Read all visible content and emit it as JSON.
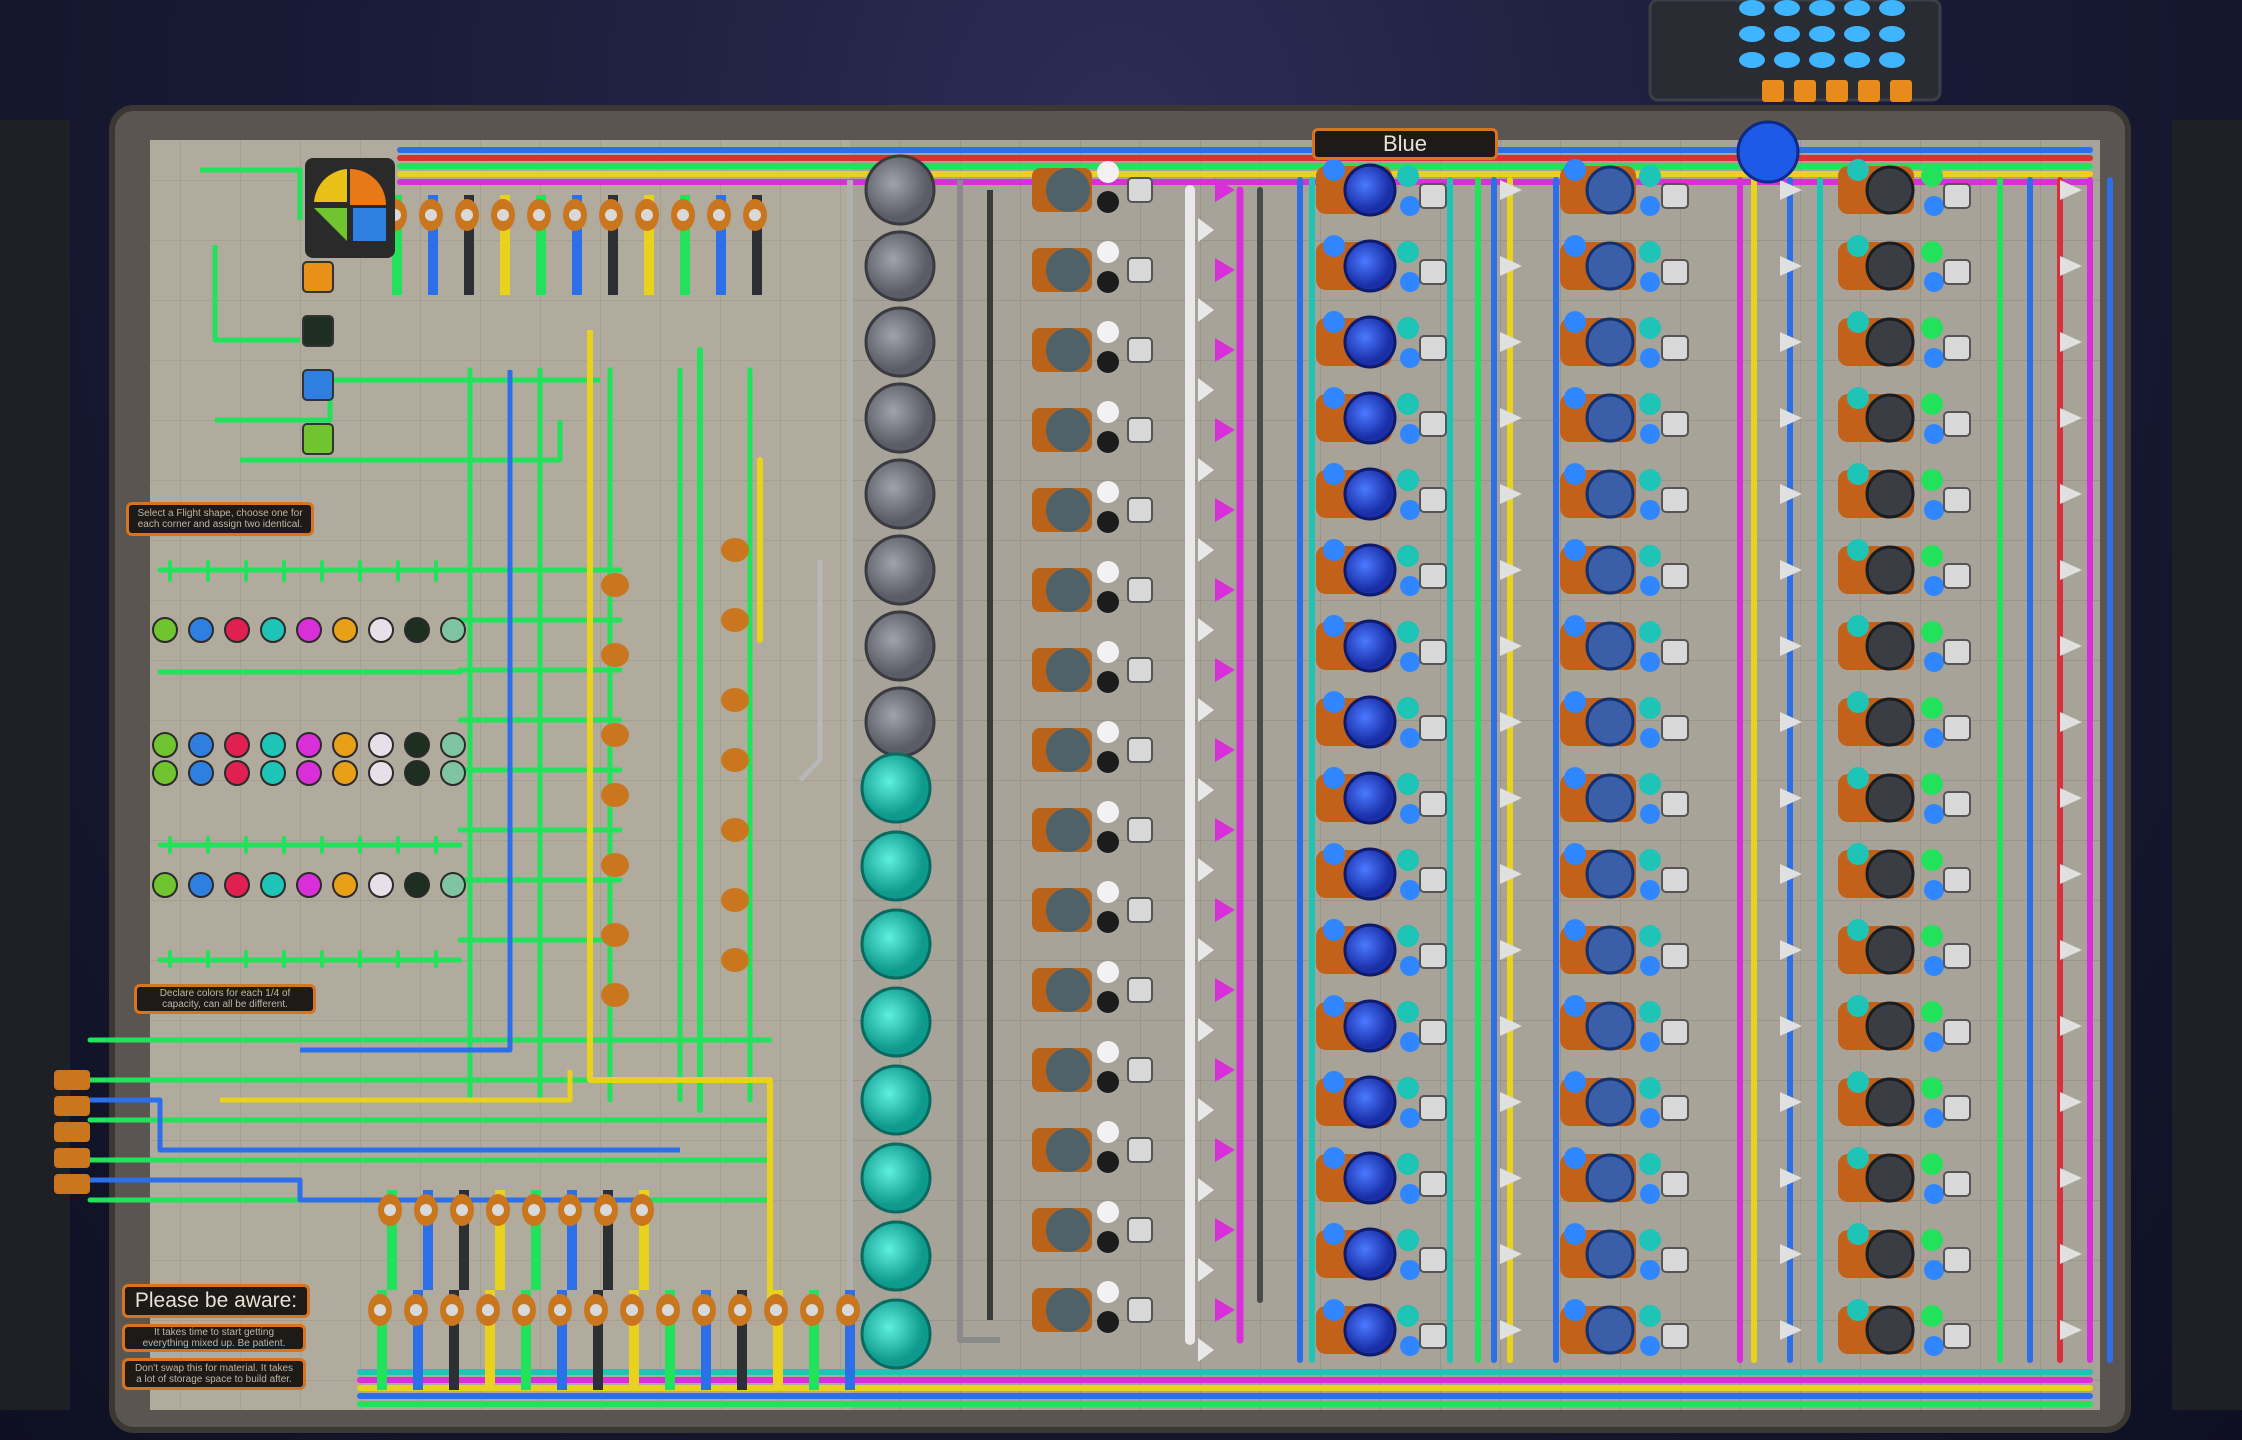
{
  "game": "Satisfactory-style factory",
  "top_sign": {
    "label": "Blue"
  },
  "warning_signs": {
    "heading": "Please be aware:",
    "note_1": "It takes time to start getting everything mixed up. Be patient.",
    "note_2": "Don't swap this for material. It takes a lot of storage space to build after."
  },
  "instruction_signs": {
    "top_left": "Select a Flight shape, choose one for each corner and assign two identical.",
    "middle_left": "Declare colors for each 1/4 of capacity, can all be different."
  },
  "colors": {
    "floor": "#a9a49a",
    "frame": "#5a5550",
    "green_pipe": "#22e25b",
    "blue_pipe": "#2c6fe8",
    "yellow_pipe": "#e8d21c",
    "white_pipe": "#e8e8e8",
    "magenta_pipe": "#d82fd8",
    "teal_pipe": "#1ec4b6",
    "red_pipe": "#d8303a",
    "orange_accent": "#d8731e",
    "dark_pipe": "#2c2f33"
  },
  "shape_preview": {
    "icon": "four-color-shape-icon",
    "quadrants": [
      "#e87818",
      "#2f7fe0",
      "#6fc42f",
      "#e8c018"
    ]
  },
  "color_swatches": [
    "#e89018",
    "#1e2e20",
    "#2f7fe0",
    "#6fc42f"
  ],
  "paint_rows": {
    "row1": [
      "#6fc42f",
      "#2f7fe0",
      "#e02050",
      "#1ec4b6",
      "#d82fd8",
      "#e8a018",
      "#e8e0e8",
      "#1e2e20",
      "#7fc4a0"
    ],
    "row2": [
      "#6fc42f",
      "#2f7fe0",
      "#e02050",
      "#1ec4b6",
      "#d82fd8",
      "#e8a018",
      "#e8e0e8",
      "#1e2e20",
      "#7fc4a0"
    ],
    "row3": [
      "#6fc42f",
      "#2f7fe0",
      "#e02050",
      "#1ec4b6",
      "#d82fd8",
      "#e8a018",
      "#e8e0e8",
      "#1e2e20",
      "#7fc4a0"
    ]
  }
}
